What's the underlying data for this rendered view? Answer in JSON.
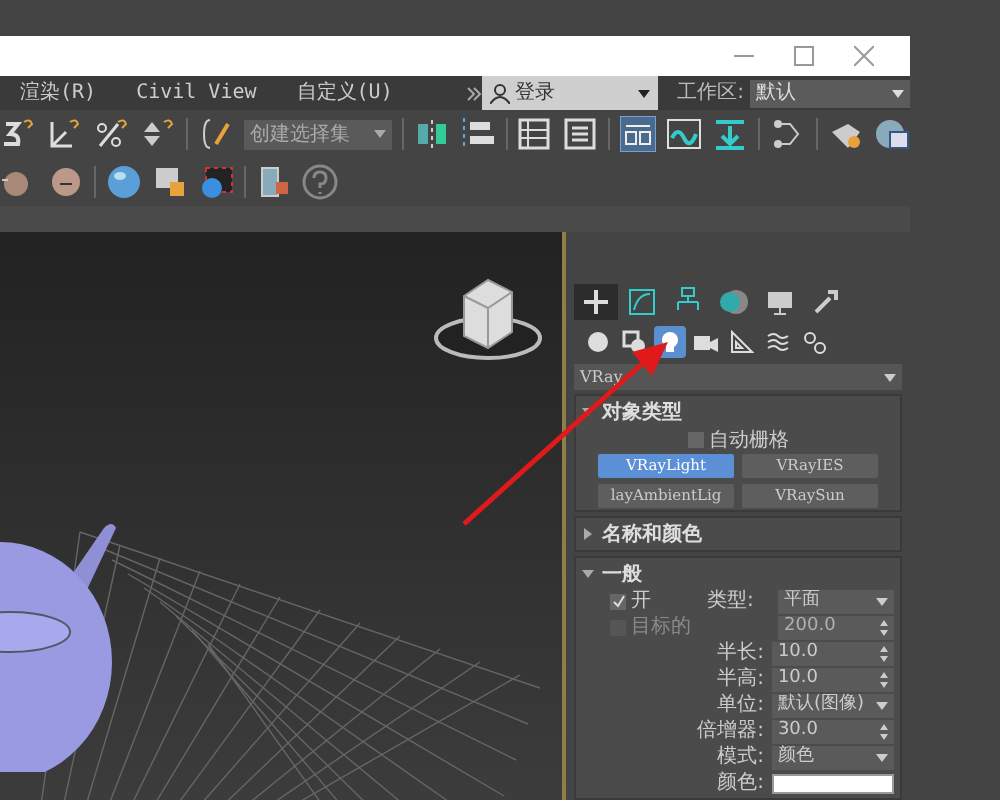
{
  "menu_bar": {
    "items": [
      "渲染(R)",
      "Civil View",
      "自定义(U)"
    ],
    "login": {
      "label": "登录"
    },
    "workspace": {
      "label": "工作区:",
      "value": "默认"
    }
  },
  "toolbar": {
    "selection_set": {
      "value": "创建选择集"
    }
  },
  "command_panel": {
    "tabs": [
      {
        "selected": true
      },
      {
        "selected": false
      },
      {
        "selected": false
      },
      {
        "selected": false
      },
      {
        "selected": false
      },
      {
        "selected": false
      }
    ],
    "categories": [
      {
        "selected": false
      },
      {
        "selected": false
      },
      {
        "selected": true
      },
      {
        "selected": false
      },
      {
        "selected": false
      },
      {
        "selected": false
      },
      {
        "selected": false
      }
    ],
    "type_dropdown": {
      "value": "VRay"
    },
    "rollouts": [
      {
        "title": "对象类型",
        "expanded": true,
        "kind": "object_type",
        "autogrid": {
          "label": "自动栅格",
          "checked": false
        },
        "buttons": [
          {
            "label": "VRayLight",
            "selected": true
          },
          {
            "label": "VRayIES",
            "selected": false
          },
          {
            "label": "layAmbientLig",
            "selected": false
          },
          {
            "label": "VRaySun",
            "selected": false
          }
        ]
      },
      {
        "title": "名称和颜色",
        "expanded": false
      },
      {
        "title": "一般",
        "expanded": true,
        "kind": "general",
        "rows": [
          {
            "kind": "check_select",
            "label": "开",
            "checked": true,
            "disabled": false,
            "field_label": "类型:",
            "value": "平面"
          },
          {
            "kind": "check_spinner",
            "label": "目标的",
            "checked": false,
            "disabled": true,
            "value": "200.0"
          },
          {
            "kind": "spinner",
            "label": "半长:",
            "value": "10.0"
          },
          {
            "kind": "spinner",
            "label": "半高:",
            "value": "10.0"
          },
          {
            "kind": "select",
            "label": "单位:",
            "value": "默认(图像)"
          },
          {
            "kind": "spinner",
            "label": "倍增器:",
            "value": "30.0"
          },
          {
            "kind": "select",
            "label": "模式:",
            "value": "颜色"
          },
          {
            "kind": "swatch",
            "label": "颜色:",
            "color": "#ffffff"
          }
        ]
      }
    ]
  }
}
